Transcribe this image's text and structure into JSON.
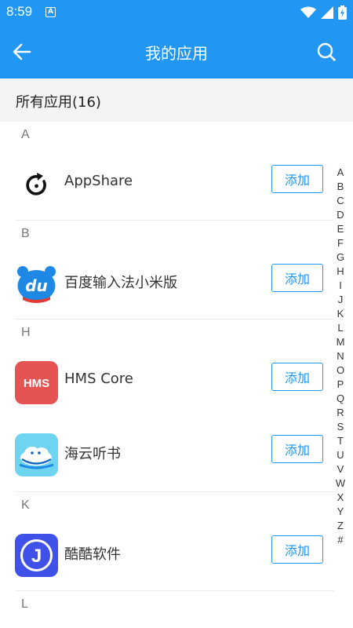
{
  "status_bar": {
    "time": "8:59",
    "notification_badge": "A"
  },
  "app_bar": {
    "title": "我的应用"
  },
  "subheader": {
    "label": "所有应用(16)"
  },
  "sections": [
    {
      "letter": "A",
      "apps": [
        {
          "name": "AppShare",
          "icon": "appshare-icon",
          "button": "添加"
        }
      ]
    },
    {
      "letter": "B",
      "apps": [
        {
          "name": "百度输入法小米版",
          "icon": "baidu-input-icon",
          "button": "添加"
        }
      ]
    },
    {
      "letter": "H",
      "apps": [
        {
          "name": "HMS Core",
          "icon": "hms-core-icon",
          "button": "添加",
          "icon_text": "HMS"
        },
        {
          "name": "海云听书",
          "icon": "haiyun-tingshu-icon",
          "button": "添加"
        }
      ]
    },
    {
      "letter": "K",
      "apps": [
        {
          "name": "酷酷软件",
          "icon": "kuku-software-icon",
          "button": "添加",
          "icon_text": "J"
        }
      ]
    },
    {
      "letter": "L",
      "apps": []
    }
  ],
  "index_letters": [
    "A",
    "B",
    "C",
    "D",
    "E",
    "F",
    "G",
    "H",
    "I",
    "J",
    "K",
    "L",
    "M",
    "N",
    "O",
    "P",
    "Q",
    "R",
    "S",
    "T",
    "U",
    "V",
    "W",
    "X",
    "Y",
    "Z",
    "#"
  ],
  "colors": {
    "primary": "#2196f3",
    "subheader_bg": "#f4f4f4",
    "hms_red": "#e55353",
    "kuku_blue": "#3f51e8",
    "haiyun_cyan": "#6fd4f0"
  }
}
